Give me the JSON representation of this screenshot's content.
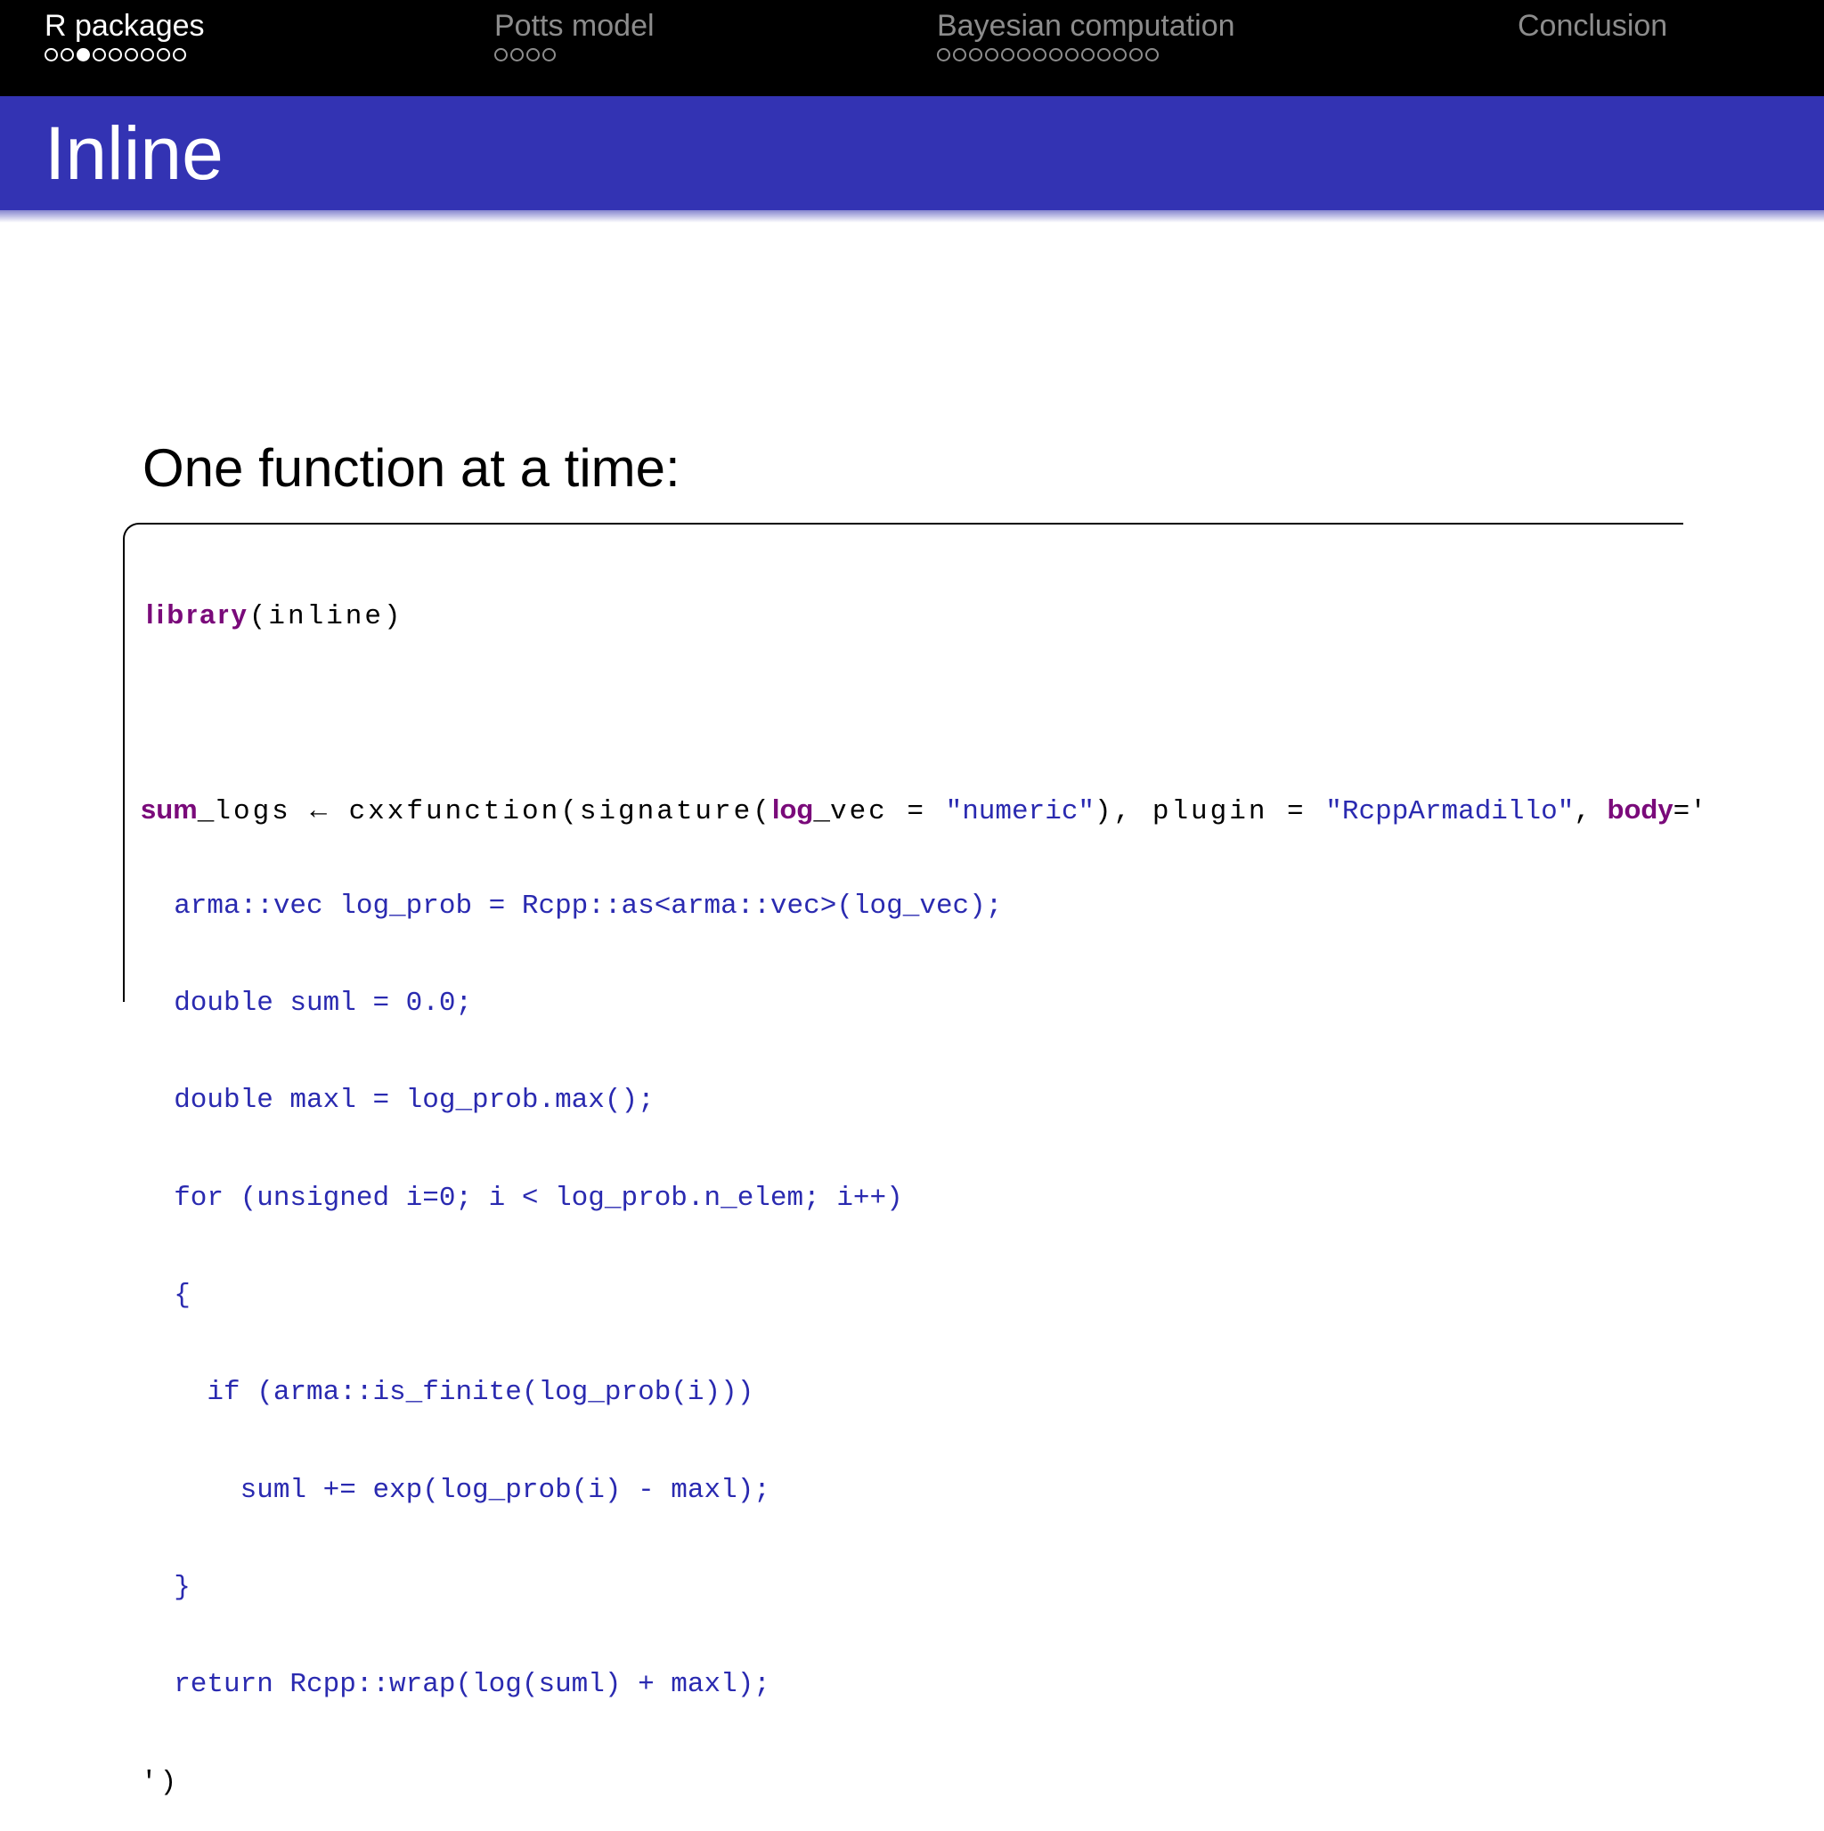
{
  "nav": {
    "sections": [
      {
        "title": "R packages",
        "active": true,
        "dots": 9,
        "current": 3
      },
      {
        "title": "Potts model",
        "active": false,
        "dots": 4,
        "current": 0
      },
      {
        "title": "Bayesian computation",
        "active": false,
        "dots": 14,
        "current": 0
      },
      {
        "title": "Conclusion",
        "active": false,
        "dots": 0,
        "current": 0
      }
    ]
  },
  "frame": {
    "title": "Inline"
  },
  "content": {
    "intro": "One function at a time:"
  },
  "code": {
    "library_kw": "library",
    "library_arg": "(inline)",
    "sum": "sum",
    "underscore": "_",
    "logs_assign": "logs ← cxxfunction(signature(",
    "log_kw": "log",
    "vec_eq": "vec = ",
    "numeric_str": "\"numeric\"",
    "sig_close": "), plugin = ",
    "plugin_str": "\"RcppArmadillo\"",
    "comma": ", ",
    "body_kw": "body",
    "body_open": "='",
    "body_lines": [
      "  arma::vec log_prob = Rcpp::as<arma::vec>(log_vec);",
      "  double suml = 0.0;",
      "  double maxl = log_prob.max();",
      "  for (unsigned i=0; i < log_prob.n_elem; i++)",
      "  {",
      "    if (arma::is_finite(log_prob(i)))",
      "      suml += exp(log_prob(i) - maxl);",
      "  }",
      "  return Rcpp::wrap(log(suml) + maxl);"
    ],
    "closing": "')"
  },
  "colors": {
    "navbar_bg": "#000000",
    "titlebar_bg": "#3333b3",
    "keyword": "#7a0a7a",
    "string": "#2a2ab0"
  }
}
